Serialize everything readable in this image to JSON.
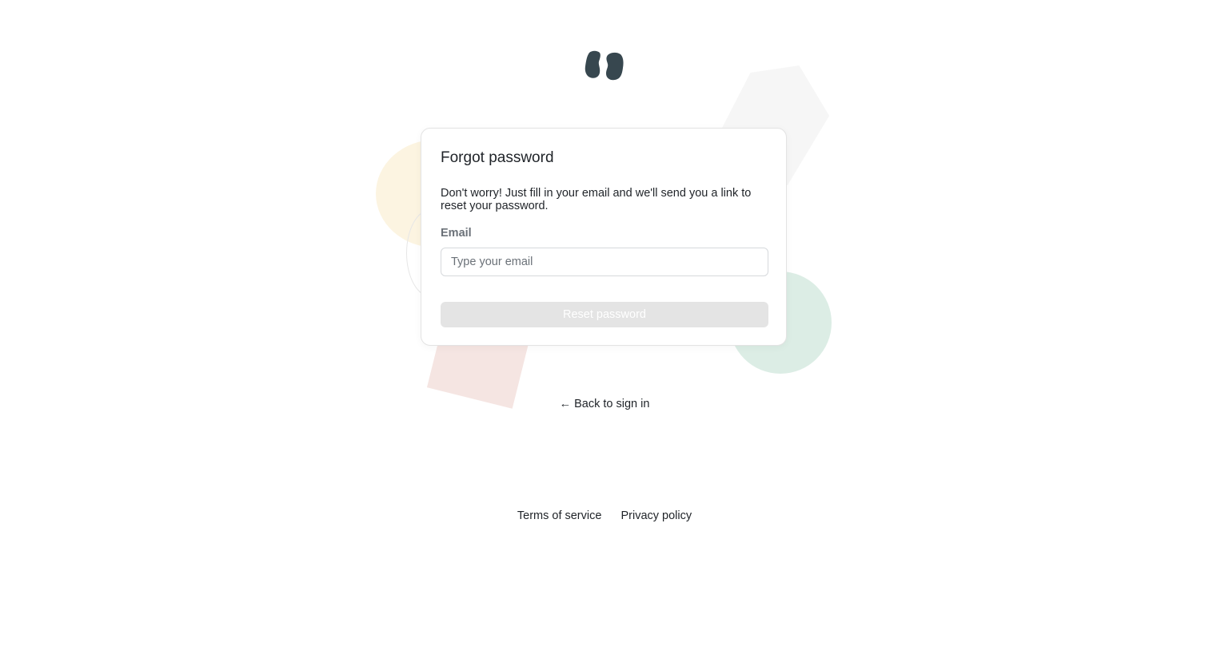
{
  "logo": {
    "icon": "quote-marks-logo-icon",
    "color": "#37474f"
  },
  "card": {
    "title": "Forgot password",
    "description": "Don't worry! Just fill in your email and we'll send you a link to reset your password.",
    "email_label": "Email",
    "email_placeholder": "Type your email",
    "email_value": "",
    "reset_label": "Reset password"
  },
  "back_link": {
    "arrow": "←",
    "label": "Back to sign in"
  },
  "footer": {
    "terms_label": "Terms of service",
    "privacy_label": "Privacy policy"
  },
  "colors": {
    "text": "#1f2328",
    "muted": "#6b7178",
    "button_disabled_bg": "#e4e4e4",
    "shape_yellow": "#fcf4e1",
    "shape_green": "#dcede5",
    "shape_pink": "#f5e5e2",
    "shape_gray": "#f6f6f6"
  }
}
